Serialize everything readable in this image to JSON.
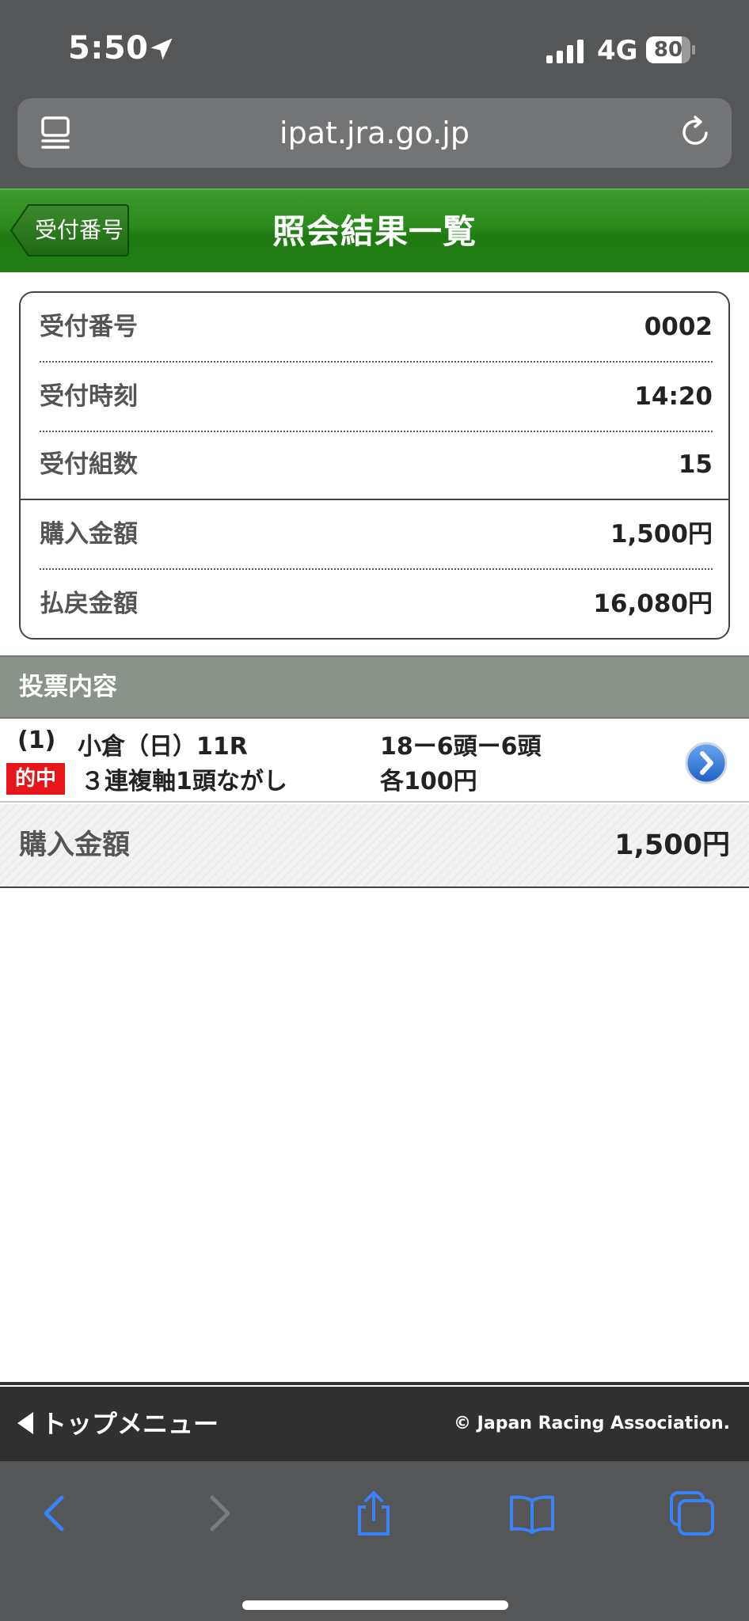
{
  "status_bar": {
    "time": "5:50",
    "network": "4G",
    "battery": "80"
  },
  "browser": {
    "url": "ipat.jra.go.jp"
  },
  "header": {
    "back_label": "受付番号",
    "title": "照会結果一覧"
  },
  "summary": {
    "rows": [
      {
        "label": "受付番号",
        "value": "0002"
      },
      {
        "label": "受付時刻",
        "value": "14:20"
      },
      {
        "label": "受付組数",
        "value": "15"
      },
      {
        "label": "購入金額",
        "value": "1,500円"
      },
      {
        "label": "払戻金額",
        "value": "16,080円"
      }
    ]
  },
  "section": {
    "title": "投票内容"
  },
  "bet": {
    "index": "(1)",
    "race": "小倉（日）11R",
    "combination": "18ー6頭ー6頭",
    "badge": "的中",
    "type": "３連複軸1頭ながし",
    "amount_each": "各100円"
  },
  "total": {
    "label": "購入金額",
    "value": "1,500円"
  },
  "footer": {
    "top_menu": "トップメニュー",
    "copyright": "© Japan Racing Association."
  },
  "colors": {
    "header_green": "#2b8a1c",
    "hit_red": "#e8161b",
    "ios_blue": "#3a82f7"
  }
}
